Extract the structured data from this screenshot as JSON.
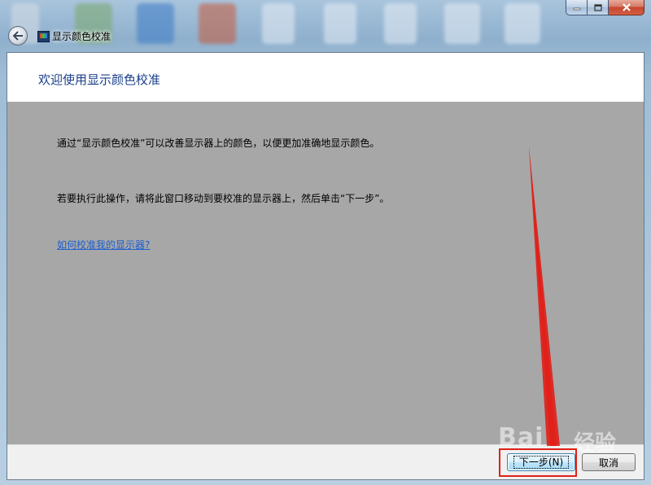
{
  "window": {
    "title": "显示颜色校准",
    "caption_buttons": [
      "minimize-icon",
      "maximize-icon",
      "close-icon"
    ]
  },
  "nav": {
    "back_icon": "back-arrow-icon"
  },
  "content": {
    "heading": "欢迎使用显示颜色校准",
    "paragraph1": "通过“显示颜色校准”可以改善显示器上的颜色，以便更加准确地显示颜色。",
    "paragraph2": "若要执行此操作，请将此窗口移动到要校准的显示器上，然后单击“下一步”。",
    "help_link": "如何校准我的显示器?"
  },
  "footer": {
    "next_label": "下一步(N)",
    "cancel_label": "取消"
  },
  "annotation": {
    "watermark": "Bai",
    "watermark_sub": "经验",
    "highlight_color": "#e0201a"
  }
}
